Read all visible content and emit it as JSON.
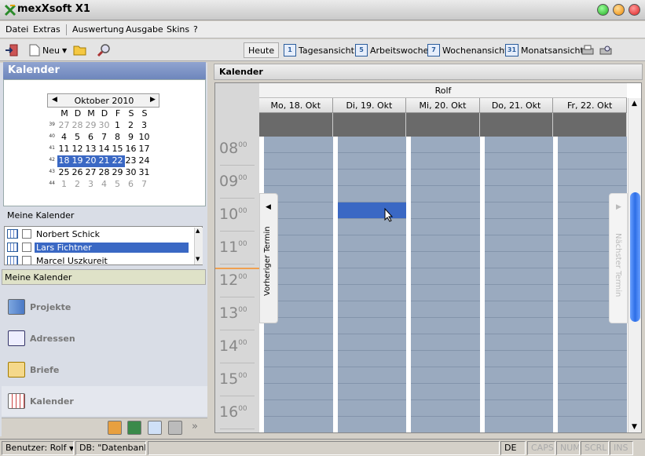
{
  "app": {
    "title": "mexXsoft X1"
  },
  "menu": [
    "Datei",
    "Extras",
    "Auswertung",
    "Ausgabe",
    "Skins",
    "?"
  ],
  "toolbar": {
    "neu_label": "Neu"
  },
  "views": {
    "heute": "Heute",
    "tagesansicht": "Tagesansicht",
    "tages_icon": "1",
    "arbeitswoche": "Arbeitswoche",
    "arbeits_icon": "5",
    "wochenansicht": "Wochenansicht",
    "wochen_icon": "7",
    "monatsansicht": "Monatsansicht",
    "monats_icon": "31"
  },
  "left": {
    "header": "Kalender",
    "minical": {
      "month": "Oktober 2010",
      "day_headers": [
        "M",
        "D",
        "M",
        "D",
        "F",
        "S",
        "S"
      ],
      "weeks": [
        {
          "num": "39",
          "days": [
            "27",
            "28",
            "29",
            "30",
            "1",
            "2",
            "3"
          ]
        },
        {
          "num": "40",
          "days": [
            "4",
            "5",
            "6",
            "7",
            "8",
            "9",
            "10"
          ]
        },
        {
          "num": "41",
          "days": [
            "11",
            "12",
            "13",
            "14",
            "15",
            "16",
            "17"
          ]
        },
        {
          "num": "42",
          "days": [
            "18",
            "19",
            "20",
            "21",
            "22",
            "23",
            "24"
          ]
        },
        {
          "num": "43",
          "days": [
            "25",
            "26",
            "27",
            "28",
            "29",
            "30",
            "31"
          ]
        },
        {
          "num": "44",
          "days": [
            "1",
            "2",
            "3",
            "4",
            "5",
            "6",
            "7"
          ]
        }
      ]
    },
    "meine_kalender_label": "Meine Kalender",
    "kalender_list": [
      "Norbert Schick",
      "Lars Fichtner",
      "Marcel Uszkureit"
    ],
    "meine_kalender_bottom": "Meine Kalender",
    "nav": [
      "Projekte",
      "Adressen",
      "Briefe",
      "Kalender"
    ],
    "nav_more": "»"
  },
  "main": {
    "header": "Kalender",
    "person": "Rolf",
    "days": [
      "Mo, 18. Okt",
      "Di, 19. Okt",
      "Mi, 20. Okt",
      "Do, 21. Okt",
      "Fr, 22. Okt"
    ],
    "hours": [
      "08",
      "09",
      "10",
      "11",
      "12",
      "13",
      "14",
      "15",
      "16"
    ],
    "minutes": "00",
    "prev_label": "Vorheriger Termin",
    "next_label": "Nächster Termin"
  },
  "status": {
    "benutzer": "Benutzer: Rolf",
    "db": "DB: \"Datenbank\"",
    "lang": "DE",
    "caps": "CAPS",
    "num": "NUM",
    "scrl": "SCRL",
    "ins": "INS"
  }
}
